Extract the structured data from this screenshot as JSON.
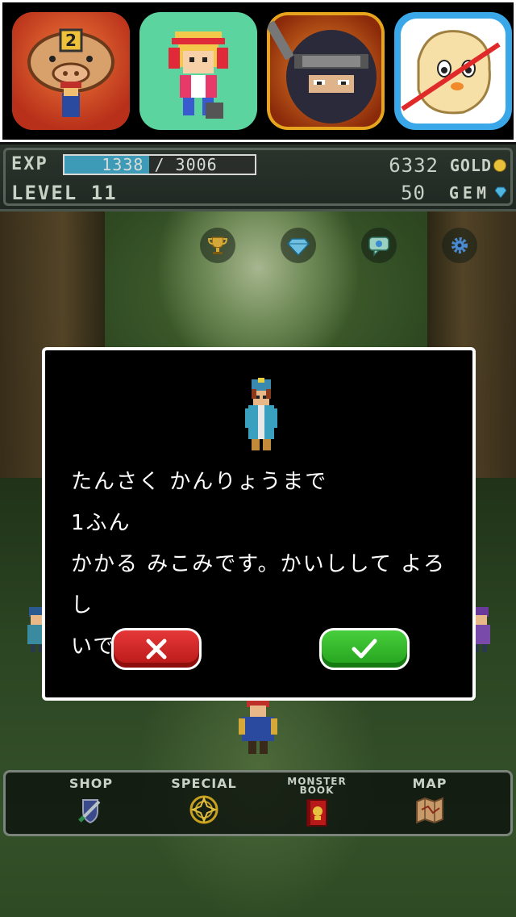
{
  "ads": [
    {
      "name": "ad-app-1",
      "badge": "2"
    },
    {
      "name": "ad-app-2"
    },
    {
      "name": "ad-app-3"
    },
    {
      "name": "ad-app-4"
    }
  ],
  "status": {
    "exp_label": "EXP",
    "exp_current": "1338",
    "exp_max": "3006",
    "exp_text": "1338 / 3006",
    "exp_fraction": 0.445,
    "level_text": "LEVEL 11",
    "gold_value": "6332",
    "gold_label": "GOLD",
    "gem_value": "50",
    "gem_label": "GEM"
  },
  "top_icons": [
    "trophy-icon",
    "gem-icon",
    "chat-icon",
    "gear-icon"
  ],
  "dialog": {
    "line1": "たんさく かんりょうまで",
    "line2": "1ふん",
    "line3": "かかる みこみです。かいしして よろし",
    "line4": "いですか?"
  },
  "nav": {
    "shop": "SHOP",
    "special": "SPECIAL",
    "monster_book_1": "MONSTER",
    "monster_book_2": "BOOK",
    "map": "MAP"
  },
  "colors": {
    "exp_fill": "#3d9bb8",
    "cancel": "#d42a2a",
    "ok": "#34b82c",
    "gold": "#e8c13a",
    "gem": "#4fb6e0"
  }
}
